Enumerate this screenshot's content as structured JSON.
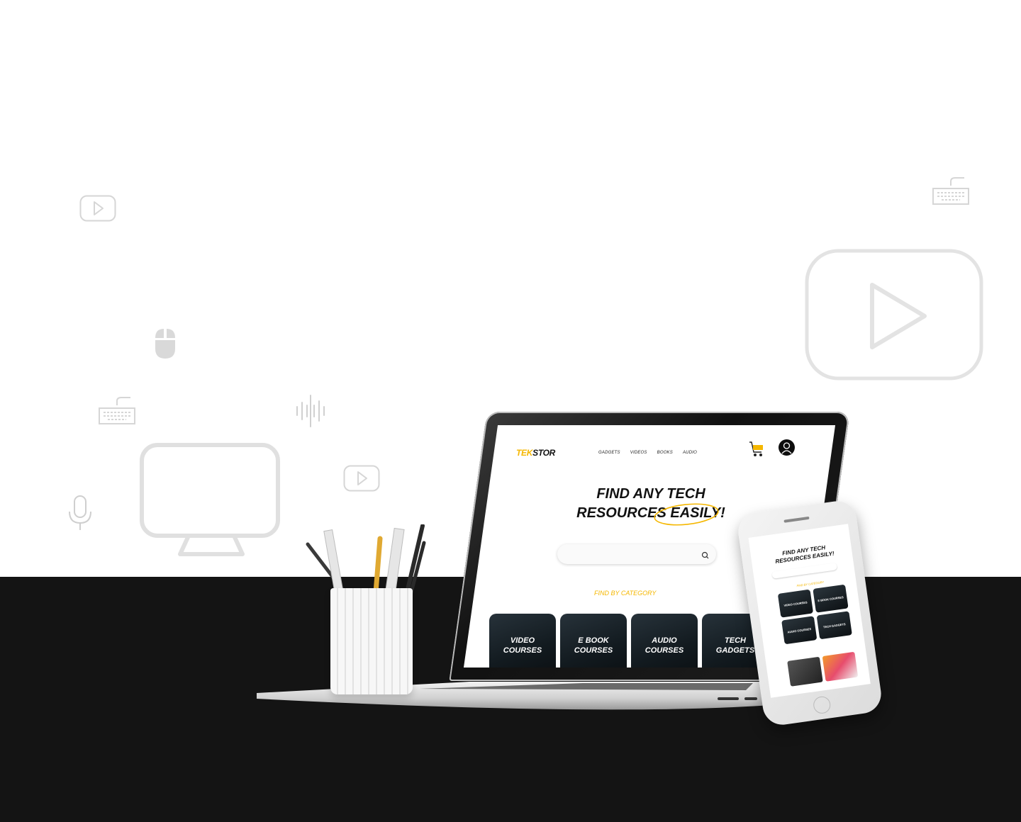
{
  "site": {
    "logo_part1": "TEK",
    "logo_part2": "STOR",
    "nav": [
      "GADGETS",
      "VIDEOS",
      "BOOKS",
      "AUDIO"
    ],
    "hero_line1": "FIND ANY TECH",
    "hero_line2": "RESOURCES EASILY!",
    "search_placeholder": "",
    "category_heading": "FIND BY CATEGORY",
    "categories": [
      {
        "label": "VIDEO COURSES"
      },
      {
        "label": "E BOOK COURSES"
      },
      {
        "label": "AUDIO COURSES"
      },
      {
        "label": "TECH GADGETS"
      }
    ]
  },
  "mobile": {
    "hero_line1": "FIND ANY TECH",
    "hero_line2": "RESOURCES EASILY!",
    "category_heading": "FIND BY CATEGORY",
    "categories": [
      "VIDEO COURSES",
      "E BOOK COURSES",
      "AUDIO COURSES",
      "TECH GADGETS"
    ]
  },
  "decorations": [
    "play-button-icon",
    "keyboard-icon",
    "mouse-icon",
    "audio-waveform-icon",
    "microphone-icon",
    "monitor-icon"
  ],
  "colors": {
    "accent": "#f5b700",
    "band": "#141414",
    "deco": "#d6d6d6"
  }
}
